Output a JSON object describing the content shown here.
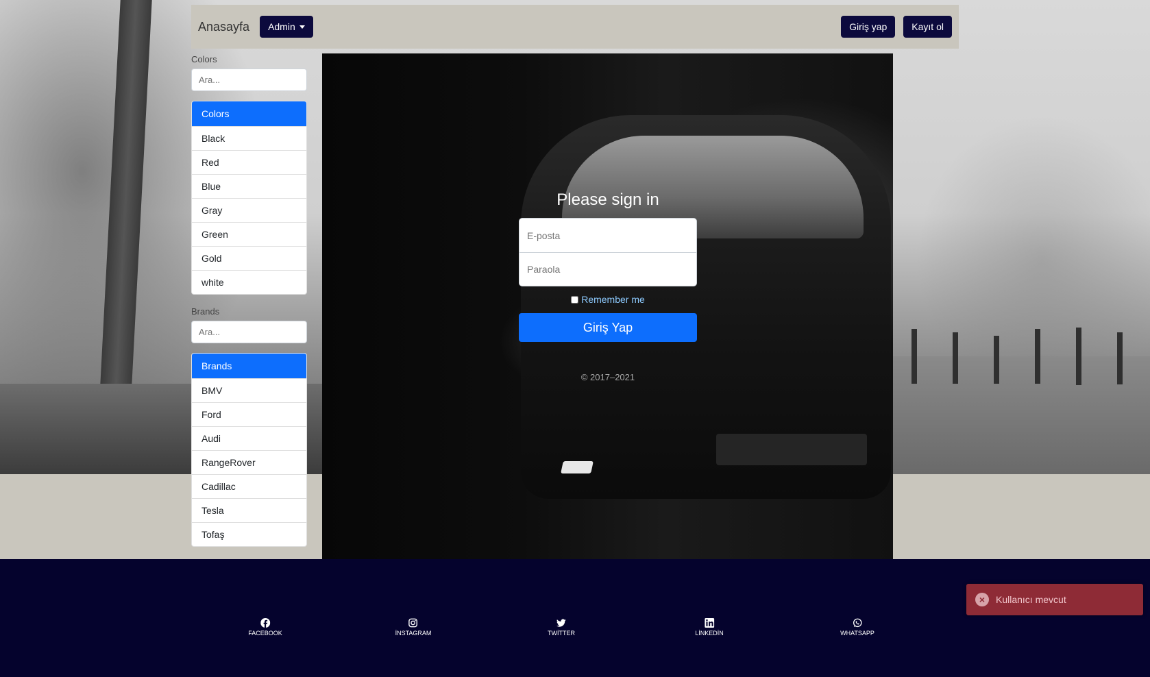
{
  "navbar": {
    "brand": "Anasayfa",
    "admin_label": "Admin",
    "login_label": "Giriş yap",
    "register_label": "Kayıt ol"
  },
  "sidebar": {
    "colors": {
      "title": "Colors",
      "search_placeholder": "Ara...",
      "items": [
        "Colors",
        "Black",
        "Red",
        "Blue",
        "Gray",
        "Green",
        "Gold",
        "white"
      ]
    },
    "brands": {
      "title": "Brands",
      "search_placeholder": "Ara...",
      "items": [
        "Brands",
        "BMV",
        "Ford",
        "Audi",
        "RangeRover",
        "Cadillac",
        "Tesla",
        "Tofaş"
      ]
    }
  },
  "signin": {
    "heading": "Please sign in",
    "email_placeholder": "E-posta",
    "password_placeholder": "Paraola",
    "remember_label": "Remember me",
    "submit_label": "Giriş Yap",
    "copyright": "© 2017–2021"
  },
  "footer": {
    "social": [
      "FACEBOOK",
      "İNSTAGRAM",
      "TWİTTER",
      "LİNKEDİN",
      "WHATSAPP"
    ]
  },
  "toast": {
    "message": "Kullanıcı mevcut"
  },
  "colors": {
    "primary": "#0d6efd",
    "nav_button": "#0c0a3d",
    "footer_bg": "#05032d",
    "toast_bg": "#8e2b36"
  }
}
